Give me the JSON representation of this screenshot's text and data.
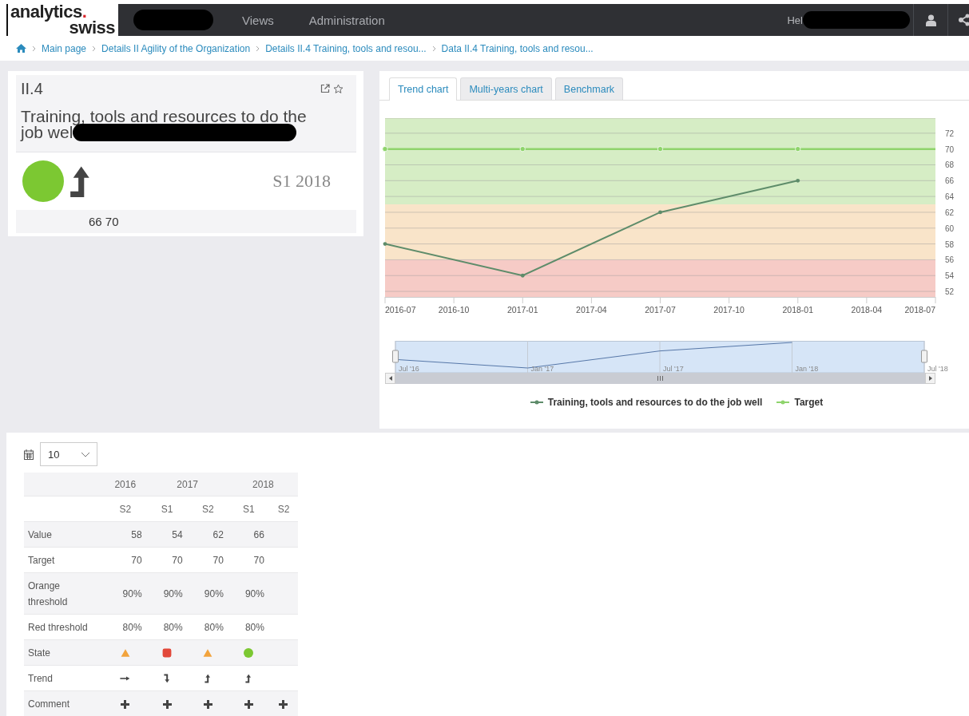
{
  "navbar": {
    "logo": {
      "top": "analytics",
      "mark": ".",
      "bottom": "swiss"
    },
    "menu": [
      {
        "label": "Views"
      },
      {
        "label": "Administration"
      }
    ],
    "greeting": "Hel"
  },
  "breadcrumb": [
    "Main page",
    "Details II Agility of the Organization",
    "Details II.4 Training, tools and resou...",
    "Data II.4 Training, tools and resou..."
  ],
  "indicator": {
    "code": "II.4",
    "title_lines": [
      "Training, tools and resources to do the",
      "job wel"
    ],
    "state": {
      "kind": "ok"
    },
    "trend": {
      "kind": "up"
    },
    "period": "S1 2018",
    "footer": "66 70"
  },
  "tabs": [
    {
      "label": "Trend chart",
      "selected": true
    },
    {
      "label": "Multi-years chart",
      "selected": false
    },
    {
      "label": "Benchmark",
      "selected": false
    }
  ],
  "chart": {
    "chart_data": {
      "type": "line",
      "grid": true,
      "ylim": [
        51.3,
        73.9
      ],
      "bands": [
        {
          "axis": "y",
          "from": 63,
          "to": 73.9,
          "color": "#d6edc5"
        },
        {
          "axis": "y",
          "from": 56,
          "to": 63,
          "color": "#f9e4c9"
        },
        {
          "axis": "y",
          "from": 51.3,
          "to": 56,
          "color": "#f6cbc6"
        }
      ],
      "categories": [
        "2016-07",
        "2016-10",
        "2017-01",
        "2017-04",
        "2017-07",
        "2017-10",
        "2018-01",
        "2018-04",
        "2018-07"
      ],
      "yticks": [
        52,
        54,
        56,
        58,
        60,
        62,
        64,
        66,
        68,
        70,
        72
      ],
      "series": [
        {
          "name": "Training, tools and resources to do the job well",
          "color": "#5e8c6a",
          "marker": true,
          "values": [
            58,
            null,
            54,
            null,
            62,
            null,
            66,
            null,
            null
          ]
        },
        {
          "name": "Target",
          "color": "#8fd46c",
          "marker": true,
          "values": [
            70,
            null,
            70,
            null,
            70,
            null,
            70,
            null,
            null
          ]
        }
      ]
    },
    "navigator": {
      "labels": [
        "Jul '16",
        "Jan '17",
        "Jul '17",
        "Jan '18",
        "Jul '18"
      ]
    }
  },
  "table": {
    "page_size": "10",
    "years": [
      {
        "label": "2016",
        "periods": [
          "S2"
        ]
      },
      {
        "label": "2017",
        "periods": [
          "S1",
          "S2"
        ]
      },
      {
        "label": "2018",
        "periods": [
          "S1",
          "S2"
        ]
      }
    ],
    "rows": [
      {
        "kind": "text",
        "label": "Value",
        "cells": [
          "58",
          "54",
          "62",
          "66"
        ]
      },
      {
        "kind": "text",
        "label": "Target",
        "cells": [
          "70",
          "70",
          "70",
          "70"
        ]
      },
      {
        "kind": "text",
        "label": "Orange threshold",
        "cells": [
          "90%",
          "90%",
          "90%",
          "90%"
        ]
      },
      {
        "kind": "text",
        "label": "Red threshold",
        "cells": [
          "80%",
          "80%",
          "80%",
          "80%"
        ]
      },
      {
        "kind": "state",
        "label": "State",
        "cells": [
          {
            "kind": "warning"
          },
          {
            "kind": "alert"
          },
          {
            "kind": "warning"
          },
          {
            "kind": "ok"
          }
        ]
      },
      {
        "kind": "trend",
        "label": "Trend",
        "cells": [
          {
            "kind": "flat"
          },
          {
            "kind": "down"
          },
          {
            "kind": "up"
          },
          {
            "kind": "up"
          }
        ]
      },
      {
        "kind": "comment",
        "label": "Comment",
        "cells": [
          {
            "kind": "add"
          },
          {
            "kind": "add"
          },
          {
            "kind": "add"
          },
          {
            "kind": "add"
          },
          {
            "kind": "add"
          }
        ]
      }
    ]
  }
}
